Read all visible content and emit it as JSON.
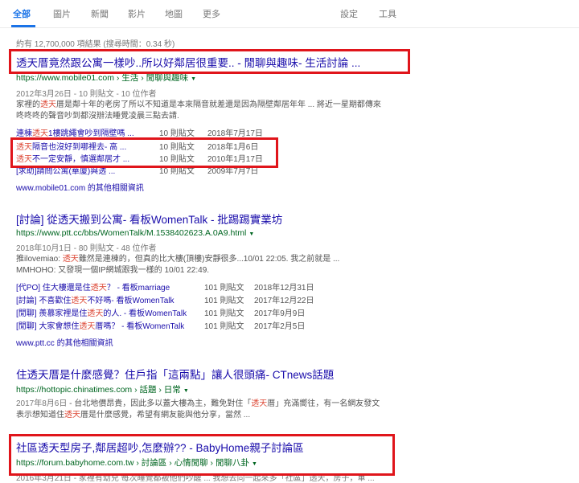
{
  "tabs": [
    "全部",
    "圖片",
    "新聞",
    "影片",
    "地圖",
    "更多"
  ],
  "settings_label": "設定",
  "tools_label": "工具",
  "stats": "約有 12,700,000 項結果 (搜尋時間：0.34 秒)",
  "results": [
    {
      "title": "透天厝竟然跟公寓一樣吵..所以好鄰居很重要.. - 閒聊與趣味- 生活討論 ...",
      "url": "https://www.mobile01.com › 生活 › 閒聊與趣味",
      "meta": "2012年3月26日 - 10 則貼文 - 10 位作者",
      "snippet_1": "家裡的透天厝是鄰十年的老房了所以不知道是本來隔音就差還是因為隔壁鄰居年年 ... 將近一星期都傳來",
      "snippet_2": "咚咚咚的聲音吵到都沒辦法睡覺凌晨三點去請.",
      "sub": [
        {
          "title": "連棟透天1樓跳繩會吵到隔壁嗎 ...",
          "count": "10 則貼文",
          "date": "2018年7月17日"
        },
        {
          "title": "透天隔音也沒好到哪裡去- 高 ...",
          "count": "10 則貼文",
          "date": "2018年1月6日"
        },
        {
          "title": "透天不一定安靜，慎選鄰居才 ...",
          "count": "10 則貼文",
          "date": "2010年1月17日"
        },
        {
          "title": "[求助]請問公寓(華廈)與透 ...",
          "count": "10 則貼文",
          "date": "2009年7月7日"
        }
      ],
      "more": "www.mobile01.com 的其他相關資訊"
    },
    {
      "title": "[討論] 從透天搬到公寓- 看板WomenTalk - 批踢踢實業坊",
      "url": "https://www.ptt.cc/bbs/WomenTalk/M.1538402623.A.0A9.html",
      "meta": "2018年10月1日 - 80 則貼文 - 48 位作者",
      "snippet_1": "推ilovemiao: 透天雖然是連棟的，但真的比大樓(頂樓)安靜很多...10/01 22:05. 我之前就是 ...",
      "snippet_2": "MMHOHO: 又發現一個IP網城跟我一樣的 10/01 22:49.",
      "sub": [
        {
          "title": "[代PO] 住大樓還是住透天？ - 看板marriage",
          "count": "101 則貼文",
          "date": "2018年12月31日"
        },
        {
          "title": "[討論] 不喜歡住透天不好嗎- 看板WomenTalk",
          "count": "101 則貼文",
          "date": "2017年12月22日"
        },
        {
          "title": "[閒聊] 羨慕家裡是住透天的人. - 看板WomenTalk",
          "count": "101 則貼文",
          "date": "2017年9月9日"
        },
        {
          "title": "[閒聊] 大家會想住透天厝嗎？ - 看板WomenTalk",
          "count": "101 則貼文",
          "date": "2017年2月5日"
        }
      ],
      "more": "www.ptt.cc 的其他相關資訊"
    },
    {
      "title": "住透天厝是什麼感覺？住戶指「這兩點」讓人很頭痛- CTnews話題",
      "url": "https://hottopic.chinatimes.com › 話題 › 日常",
      "meta": "2017年8月6日",
      "snippet_1": " - 台北地價昂貴，因此多以蓋大樓為主，難免對住「透天厝」充滿嚮往，有一名網友發文",
      "snippet_2": "表示想知道住透天厝是什麼感覺，希望有網友能與他分享，當然 ..."
    },
    {
      "title": "社區透天型房子,鄰居超吵,怎麼辦?? - BabyHome親子討論區",
      "url": "https://forum.babyhome.com.tw › 討論區 › 心情閒聊 › 閒聊八卦",
      "meta": "2016年3月21日 - 家裡有幼兒 每次睡覺都被他們吵醒 ... 我想去向一起來多「社區」透天，房子，單 ..."
    }
  ],
  "highlight_color": "#dd4b39",
  "box_color": "#e0151b"
}
